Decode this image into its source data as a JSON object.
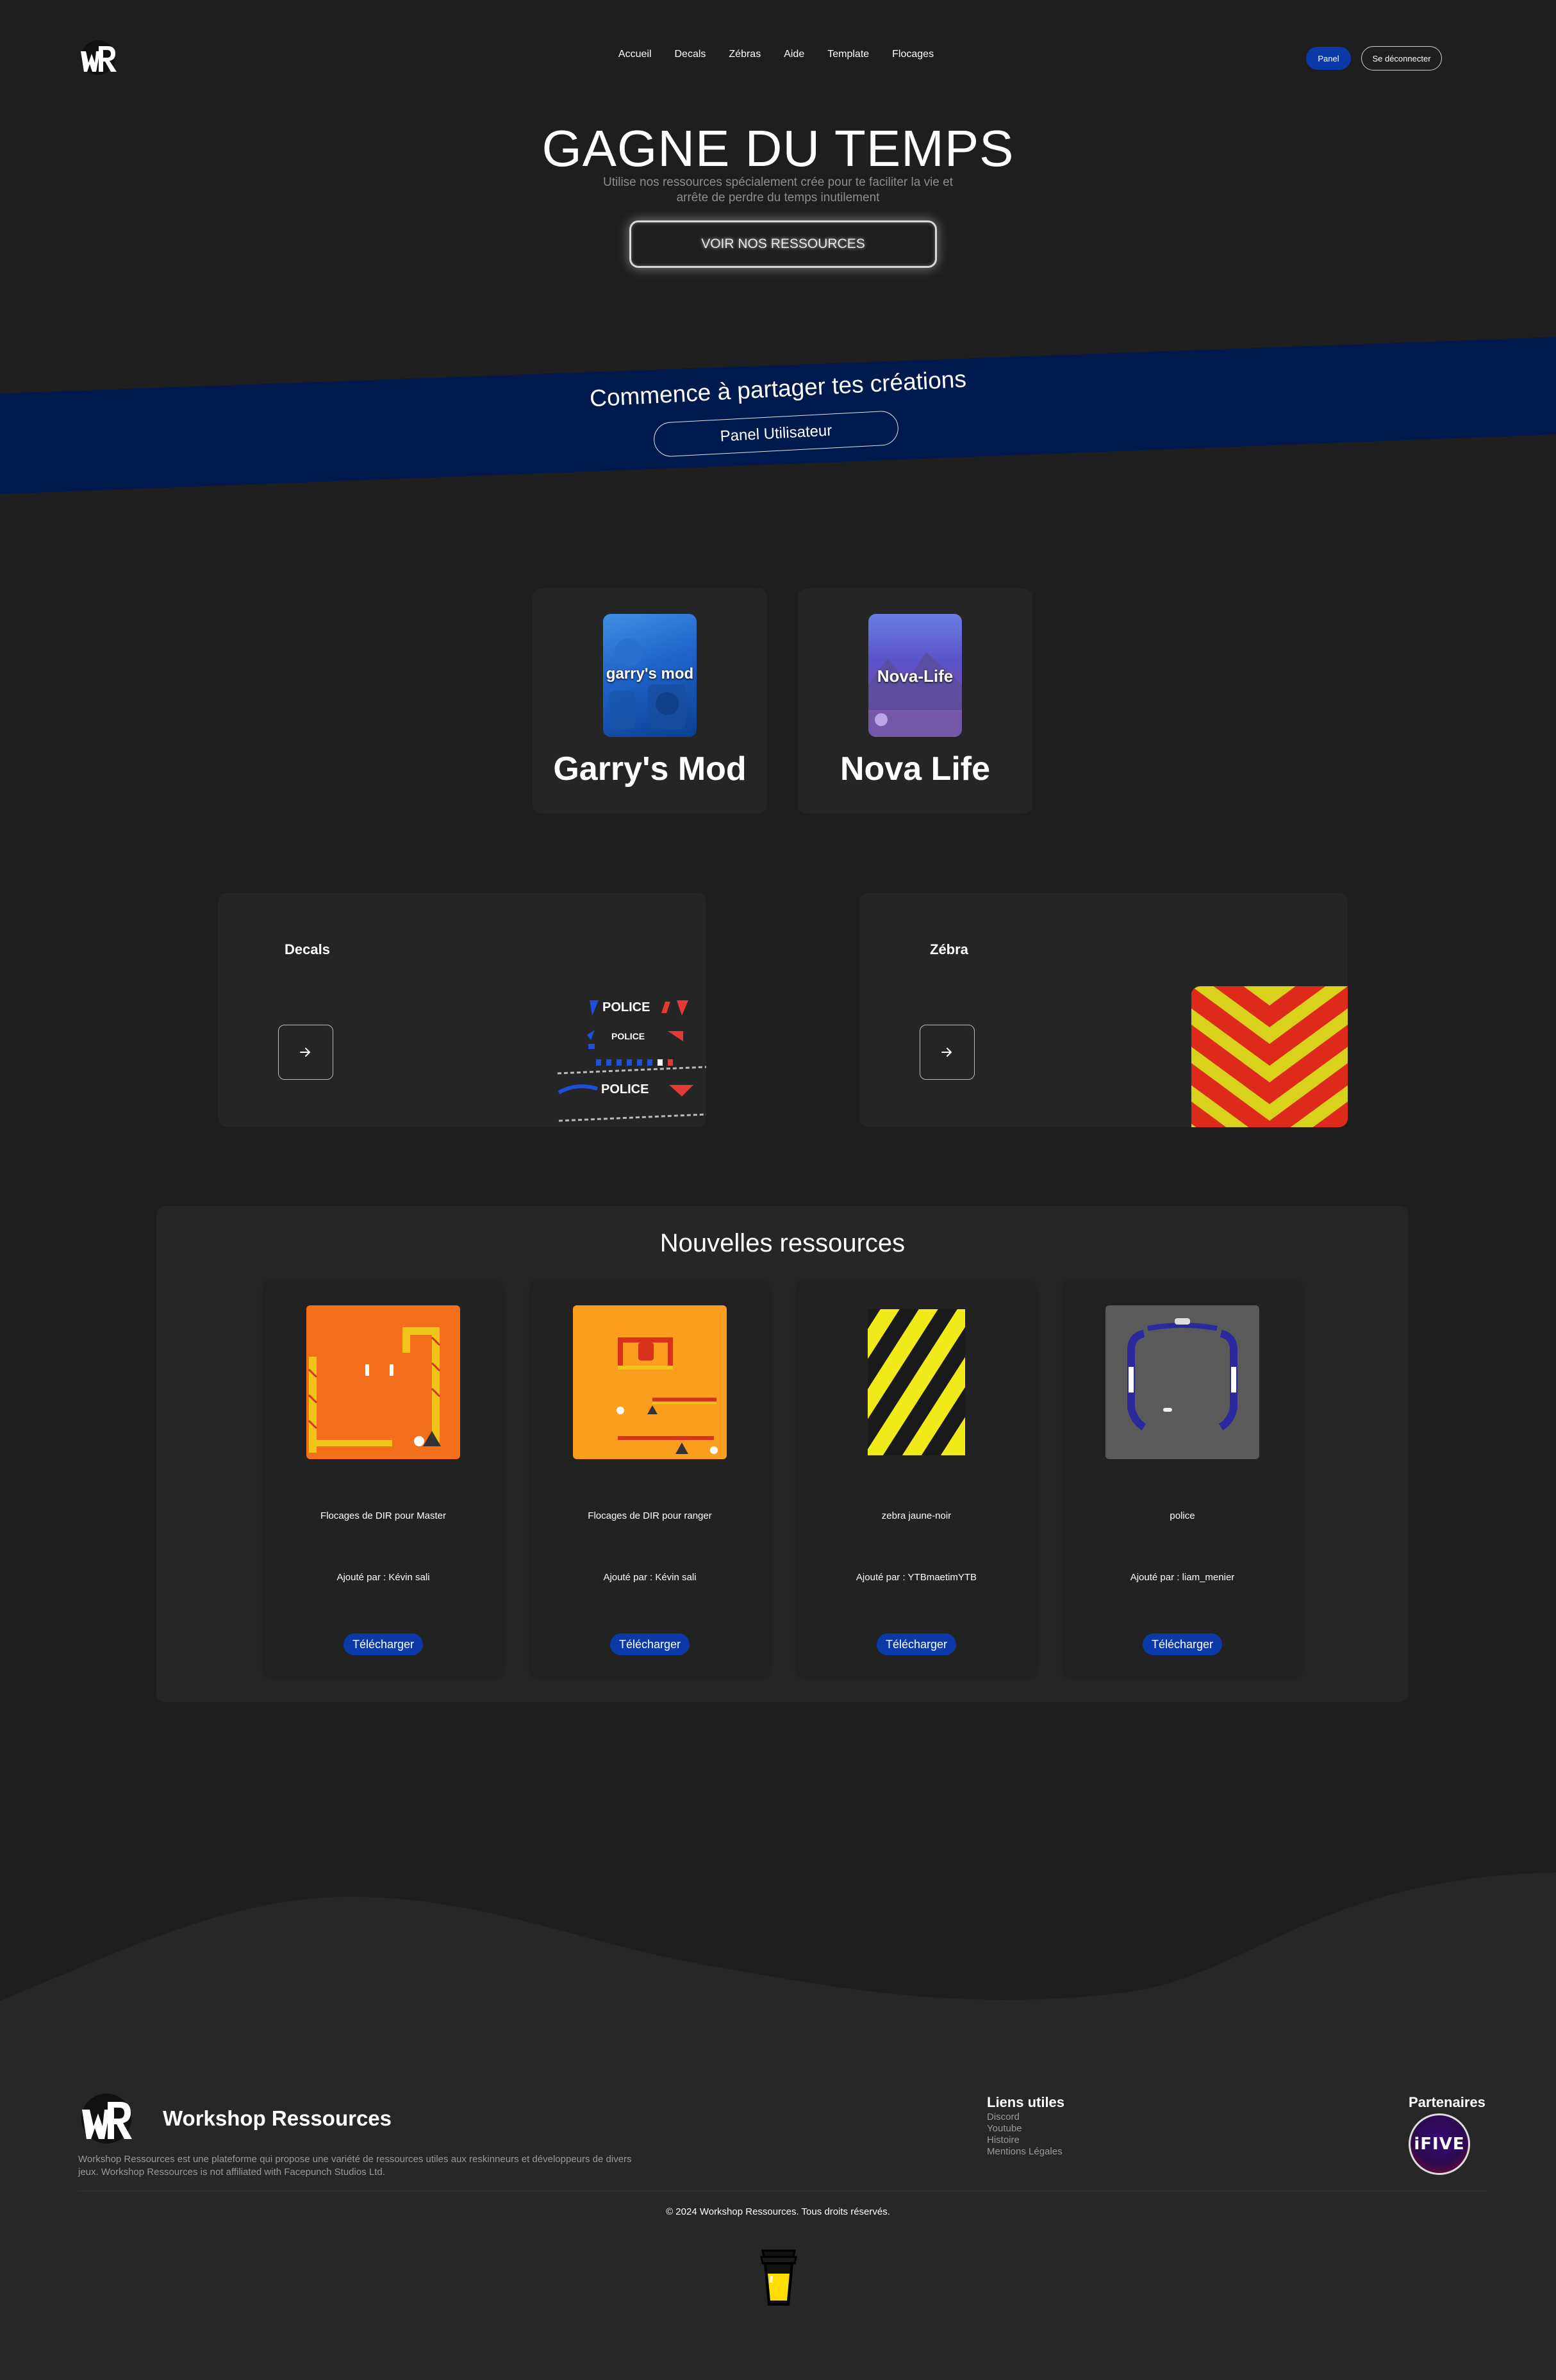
{
  "nav": {
    "items": [
      "Accueil",
      "Decals",
      "Zébras",
      "Aide",
      "Template",
      "Flocages"
    ],
    "panel_label": "Panel",
    "logout_label": "Se déconnecter"
  },
  "hero": {
    "title": "GAGNE DU TEMPS",
    "subtitle": "Utilise nos ressources spécialement crée pour te faciliter la vie et arrête de perdre du temps inutilement",
    "cta_label": "VOIR NOS RESSOURCES"
  },
  "band": {
    "title": "Commence à partager tes créations",
    "button_label": "Panel Utilisateur"
  },
  "games": [
    {
      "name": "Garry's Mod",
      "image_text": "garry's mod"
    },
    {
      "name": "Nova Life",
      "image_text": "Nova-Life"
    }
  ],
  "categories": [
    {
      "title": "Decals",
      "decal_word": "POLICE"
    },
    {
      "title": "Zébra"
    }
  ],
  "new_resources": {
    "title": "Nouvelles ressources",
    "items": [
      {
        "name": "Flocages de DIR pour Master",
        "added_by": "Ajouté par : Kévin sali",
        "download_label": "Télécharger"
      },
      {
        "name": "Flocages de DIR pour ranger",
        "added_by": "Ajouté par : Kévin sali",
        "download_label": "Télécharger"
      },
      {
        "name": "zebra jaune-noir",
        "added_by": "Ajouté par : YTBmaetimYTB",
        "download_label": "Télécharger"
      },
      {
        "name": "police",
        "added_by": "Ajouté par : liam_menier",
        "download_label": "Télécharger"
      }
    ]
  },
  "footer": {
    "brand": "Workshop Ressources",
    "description": "Workshop Ressources est une plateforme qui propose une variété de ressources utiles aux reskinneurs et développeurs de divers jeux. Workshop Ressources is not affiliated with Facepunch Studios Ltd.",
    "links_title": "Liens utiles",
    "links": [
      "Discord",
      "Youtube",
      "Histoire",
      "Mentions Légales"
    ],
    "partners_title": "Partenaires",
    "partner_logo_text": "iFIVE",
    "copyright": "© 2024 Workshop Ressources. Tous droits réservés."
  },
  "colors": {
    "background": "#1e1e1e",
    "card": "#252525",
    "accent_blue": "#0b3aa8",
    "band_blue": "#001a4d"
  }
}
